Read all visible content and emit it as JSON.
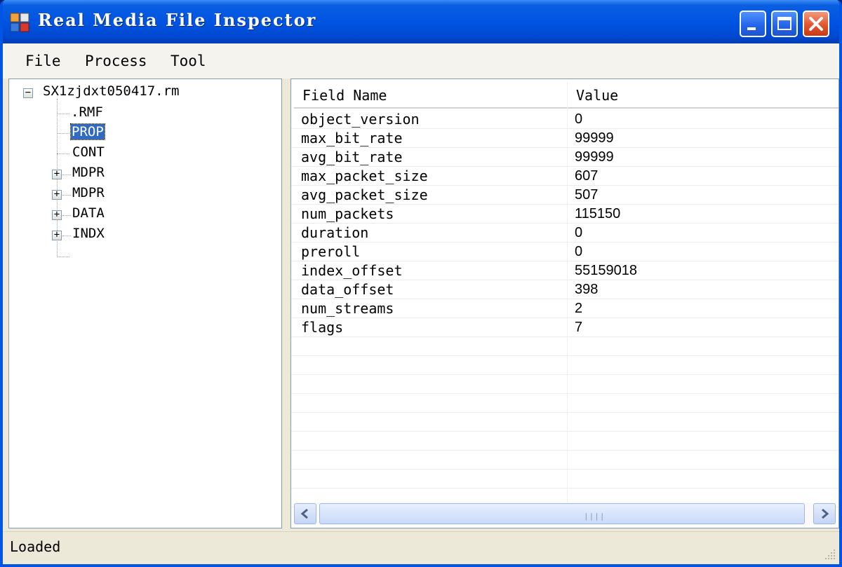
{
  "window": {
    "title": "Real Media File Inspector"
  },
  "menu": [
    "File",
    "Process",
    "Tool"
  ],
  "tree": {
    "root": "SX1zjdxt050417.rm",
    "children": [
      {
        "label": ".RMF",
        "expandable": false,
        "selected": false
      },
      {
        "label": "PROP",
        "expandable": true,
        "selected": true
      },
      {
        "label": "CONT",
        "expandable": false,
        "selected": false
      },
      {
        "label": "MDPR",
        "expandable": true,
        "selected": false
      },
      {
        "label": "MDPR",
        "expandable": true,
        "selected": false
      },
      {
        "label": "DATA",
        "expandable": true,
        "selected": false
      },
      {
        "label": "INDX",
        "expandable": true,
        "selected": false
      }
    ]
  },
  "table": {
    "columns": [
      "Field Name",
      "Value"
    ],
    "rows": [
      [
        "object_version",
        "0"
      ],
      [
        "max_bit_rate",
        "99999"
      ],
      [
        "avg_bit_rate",
        "99999"
      ],
      [
        "max_packet_size",
        "607"
      ],
      [
        "avg_packet_size",
        "507"
      ],
      [
        "num_packets",
        "115150"
      ],
      [
        "duration",
        "0"
      ],
      [
        "preroll",
        "0"
      ],
      [
        "index_offset",
        "55159018"
      ],
      [
        "data_offset",
        "398"
      ],
      [
        "num_streams",
        "2"
      ],
      [
        "flags",
        "7"
      ]
    ]
  },
  "status": {
    "text": "Loaded"
  },
  "colors": {
    "titlebar": "#0054e3",
    "selection": "#316ac5",
    "close_button": "#e2552e"
  }
}
